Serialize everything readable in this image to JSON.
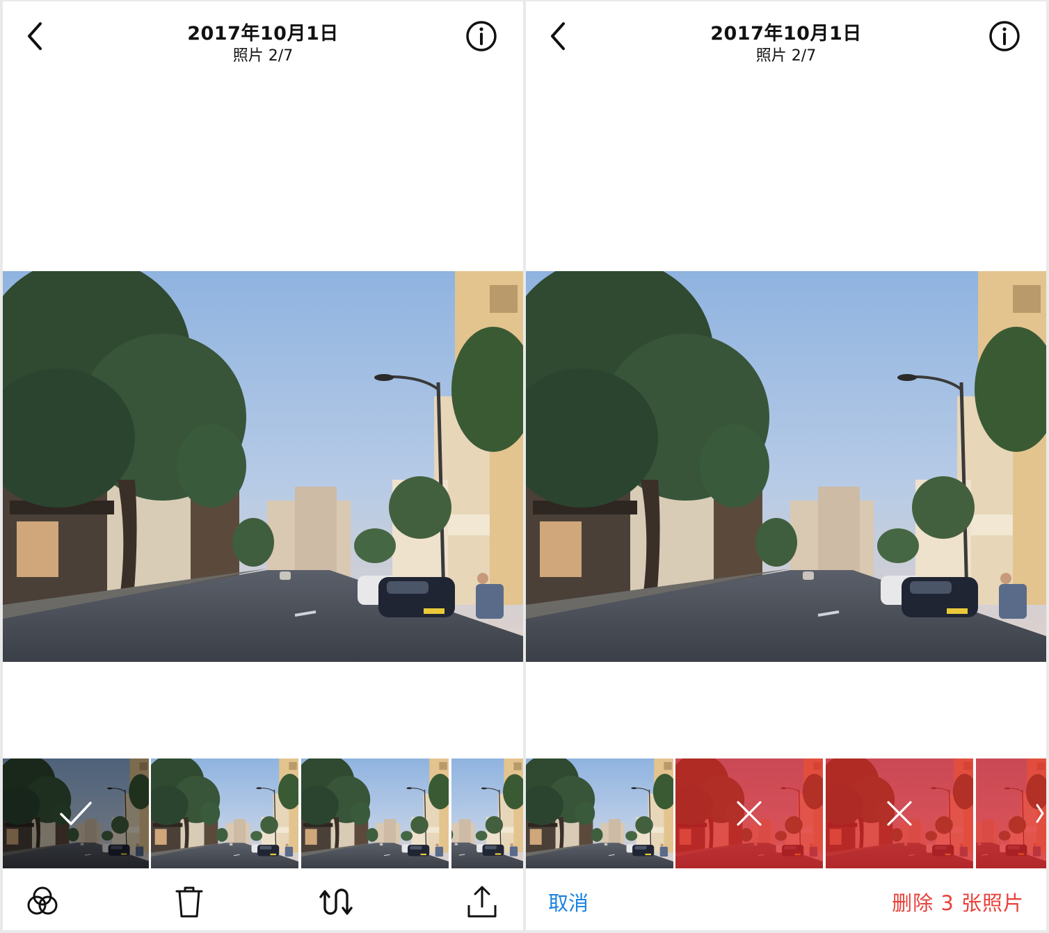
{
  "screens": [
    {
      "header": {
        "date": "2017年10月1日",
        "count": "照片 2/7"
      },
      "icons": {
        "back": "chevron-left-icon",
        "info": "info-circle-icon"
      },
      "toolbar": {
        "filters": "overlapping-circles-icon",
        "delete": "trash-icon",
        "shuffle": "swap-arrows-icon",
        "share": "share-upload-icon"
      },
      "thumbnails": [
        {
          "state": "selected-check",
          "mark": "checkmark-icon"
        },
        {
          "state": "normal"
        },
        {
          "state": "normal"
        },
        {
          "state": "normal"
        }
      ]
    },
    {
      "header": {
        "date": "2017年10月1日",
        "count": "照片 2/7"
      },
      "icons": {
        "back": "chevron-left-icon",
        "info": "info-circle-icon"
      },
      "toolbar": {
        "cancel_label": "取消",
        "delete_label": "删除 3 张照片"
      },
      "thumbnails": [
        {
          "state": "normal"
        },
        {
          "state": "marked-delete",
          "mark": "x-icon"
        },
        {
          "state": "marked-delete",
          "mark": "x-icon"
        },
        {
          "state": "marked-delete",
          "mark": "chevron-right-icon"
        }
      ]
    }
  ],
  "colors": {
    "cancel": "#1a82e2",
    "delete": "#e8403a",
    "delete_overlay": "#e02020"
  }
}
